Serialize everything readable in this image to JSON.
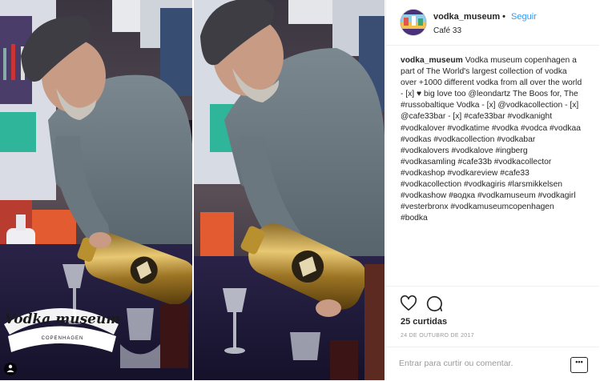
{
  "post": {
    "username": "vodka_museum",
    "separator": "•",
    "follow_label": "Seguir",
    "location": "Café 33"
  },
  "caption": {
    "username": "vodka_museum",
    "text": " Vodka museum copenhagen a part of The World's largest collection of vodka over +1000 different vodka from all over the world - [x] ♥ big love too @leondartz The Boos for, The #russobaltique Vodka - [x] @vodkacollection - [x] @cafe33bar - [x] #cafe33bar #vodkanight #vodkalover #vodkatime #vodka #vodca #vodkaa #vodkas #vodkacollection #vodkabar #vodkalovers #vodkalove #ingberg #vodkasamling #cafe33b #vodkacollector #vodkashop #vodkareview #cafe33 #vodkacollection #vodkagiris #larsmikkelsen #vodkashow #водка #vodkamuseum #vodkagirl #vesterbronx #vodkamuseumcopenhagen #bodka"
  },
  "stats": {
    "likes": "25 curtidas",
    "date": "24 DE OUTUBRO DE 2017"
  },
  "comment": {
    "placeholder": "Entrar para curtir ou comentar.",
    "more_label": "•••"
  },
  "media": {
    "logo_line1": "Vodka museum",
    "logo_line2": "COPENHAGEN"
  },
  "icons": {
    "like": "heart-icon",
    "comment": "comment-icon",
    "more": "more-options-icon"
  },
  "colors": {
    "link": "#3897f0",
    "text": "#262626",
    "muted": "#999999",
    "divider": "#efefef"
  }
}
